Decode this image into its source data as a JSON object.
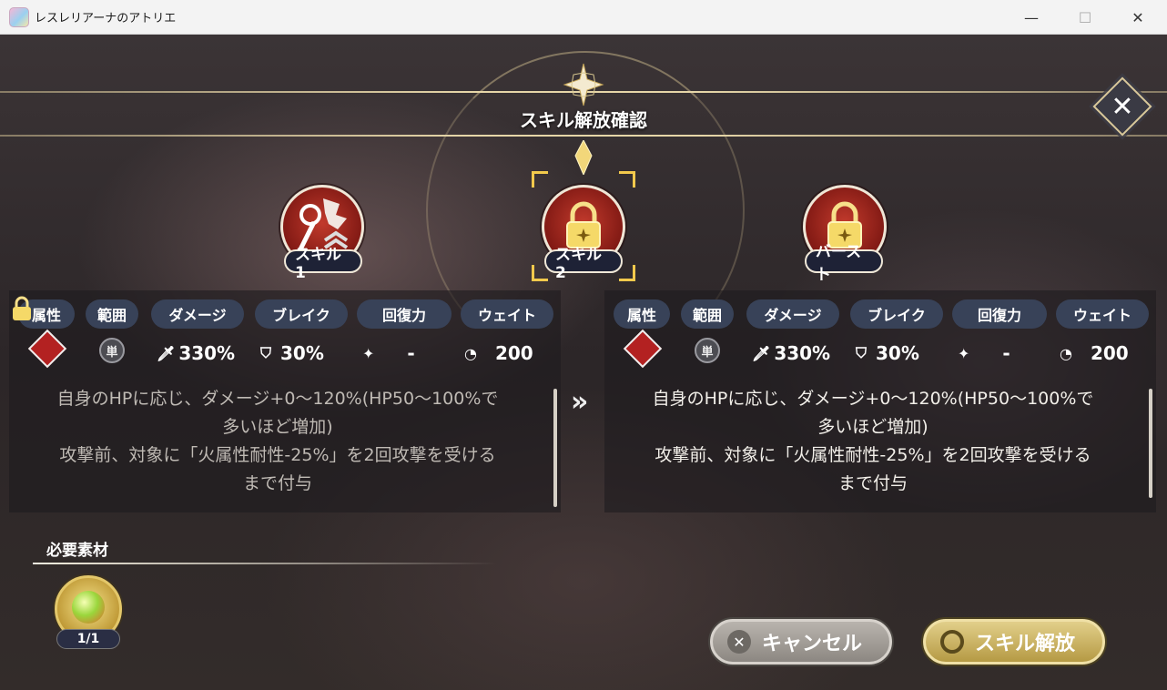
{
  "window": {
    "title": "レスレリアーナのアトリエ",
    "minimize": "—",
    "maximize": "☐",
    "close": "✕"
  },
  "dialog": {
    "title": "スキル解放確認",
    "close_icon": "✕"
  },
  "skills": [
    {
      "label": "スキル1",
      "locked": false
    },
    {
      "label": "スキル2",
      "locked": true,
      "selected": true
    },
    {
      "label": "バースト",
      "locked": true
    }
  ],
  "stat_headers": [
    "属性",
    "範囲",
    "ダメージ",
    "ブレイク",
    "回復力",
    "ウェイト"
  ],
  "before": {
    "locked": true,
    "range": "単",
    "damage": "330%",
    "break": "30%",
    "heal": "-",
    "wait": "200",
    "description": [
      "自身のHPに応じ、ダメージ+0～120%(HP50～100%で",
      "多いほど増加)",
      "攻撃前、対象に「火属性耐性-25%」を2回攻撃を受ける",
      "まで付与"
    ]
  },
  "after": {
    "range": "単",
    "damage": "330%",
    "break": "30%",
    "heal": "-",
    "wait": "200",
    "description": [
      "自身のHPに応じ、ダメージ+0～120%(HP50～100%で",
      "多いほど増加)",
      "攻撃前、対象に「火属性耐性-25%」を2回攻撃を受ける",
      "まで付与"
    ]
  },
  "arrow": "»",
  "materials": {
    "title": "必要素材",
    "items": [
      {
        "name": "green-fruit-item",
        "count": "1/1"
      }
    ]
  },
  "buttons": {
    "cancel": "キャンセル",
    "confirm": "スキル解放"
  },
  "colors": {
    "accent_gold": "#e6d6a8",
    "header_pill": "#384258",
    "fire_red": "#b32121"
  }
}
